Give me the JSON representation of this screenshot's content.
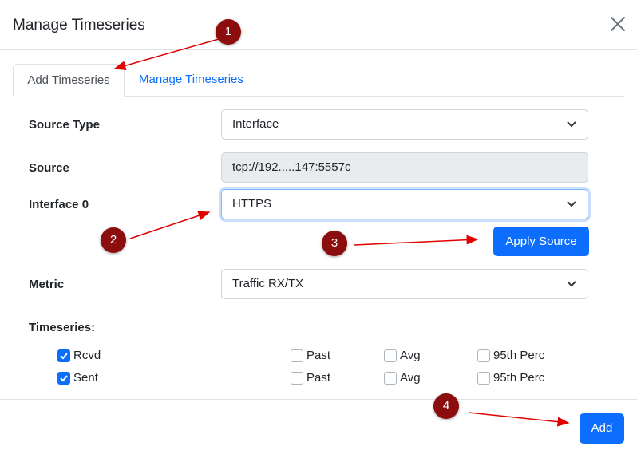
{
  "modal": {
    "title": "Manage Timeseries",
    "close_icon": "close-icon"
  },
  "tabs": [
    {
      "label": "Add Timeseries",
      "active": true
    },
    {
      "label": "Manage Timeseries",
      "active": false
    }
  ],
  "form": {
    "source_type": {
      "label": "Source Type",
      "value": "Interface"
    },
    "source": {
      "label": "Source",
      "value": "tcp://192.....147:5557c"
    },
    "interface": {
      "label": "Interface 0",
      "value": "HTTPS"
    },
    "apply_source_label": "Apply Source",
    "metric": {
      "label": "Metric",
      "value": "Traffic RX/TX"
    },
    "timeseries_label": "Timeseries:"
  },
  "timeseries": [
    {
      "name": "Rcvd",
      "checked": true,
      "past": "Past",
      "avg": "Avg",
      "perc": "95th Perc"
    },
    {
      "name": "Sent",
      "checked": true,
      "past": "Past",
      "avg": "Avg",
      "perc": "95th Perc"
    }
  ],
  "footer": {
    "add_label": "Add"
  },
  "annotations": [
    "1",
    "2",
    "3",
    "4"
  ],
  "colors": {
    "primary": "#0d6efd",
    "marker": "#8b0d0d",
    "arrow": "#e00000"
  }
}
